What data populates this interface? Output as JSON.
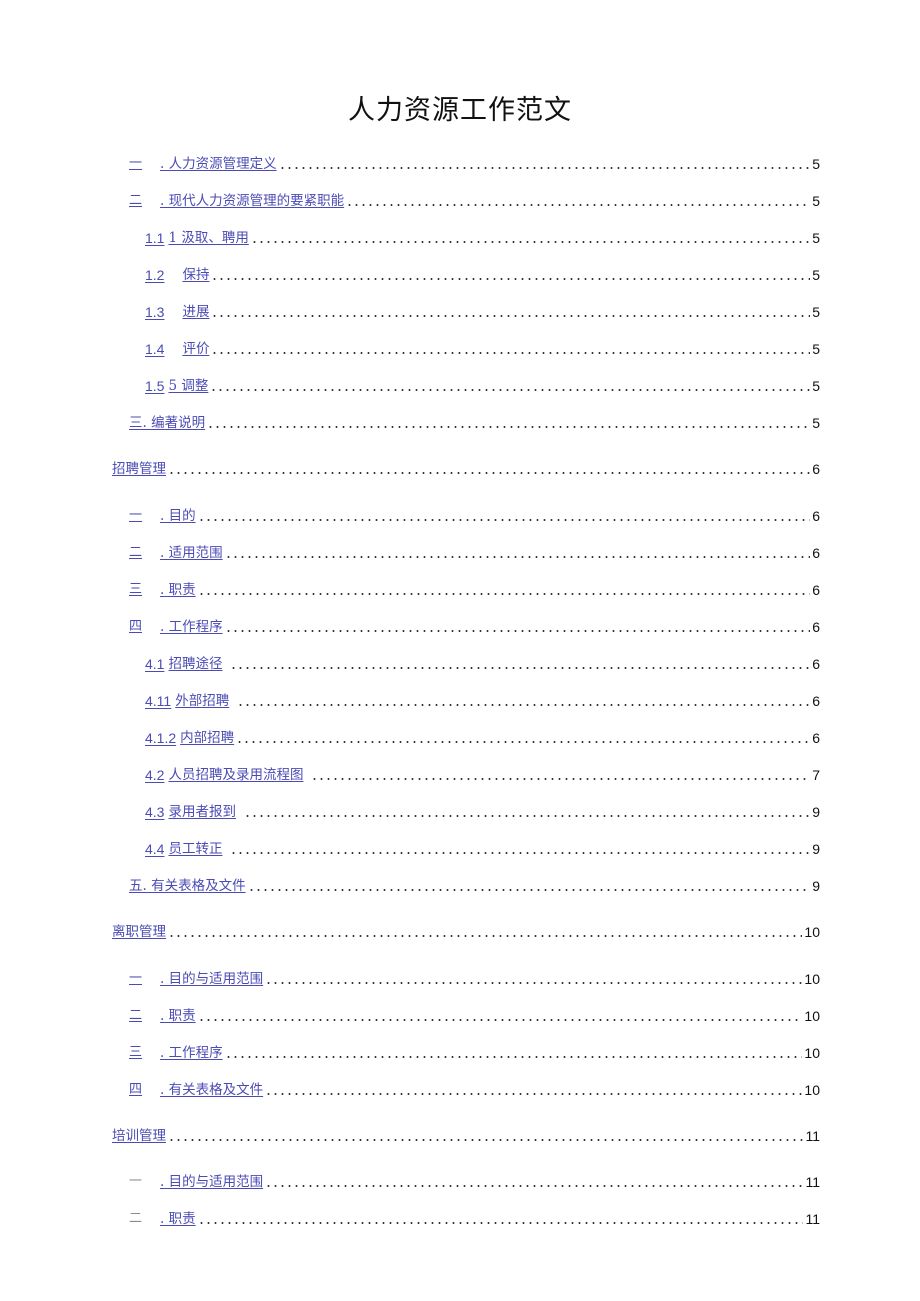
{
  "document": {
    "title": "人力资源工作范文"
  },
  "toc": [
    {
      "level": 1,
      "num": "一",
      "text": ". 人力资源管理定义",
      "page": "5"
    },
    {
      "level": 1,
      "num": "二",
      "text": ". 现代人力资源管理的要紧职能",
      "page": "5"
    },
    {
      "level": 2,
      "num": "1.1",
      "text": "1 汲取、聘用",
      "page": "5"
    },
    {
      "level": 2,
      "num": "1.2",
      "text": "保持",
      "page": "5"
    },
    {
      "level": 2,
      "num": "1.3",
      "text": "进展",
      "page": "5"
    },
    {
      "level": 2,
      "num": "1.4",
      "text": "评价",
      "page": "5"
    },
    {
      "level": 2,
      "num": "1.5",
      "text": "5 调整",
      "page": "5"
    },
    {
      "level": 1,
      "num": "",
      "text": "三. 编著说明",
      "page": "5"
    },
    {
      "level": 0,
      "num": "",
      "text": "招聘管理",
      "page": "6"
    },
    {
      "level": 1,
      "num": "一",
      "text": ". 目的",
      "page": "6"
    },
    {
      "level": 1,
      "num": "二",
      "text": ". 适用范围",
      "page": "6"
    },
    {
      "level": 1,
      "num": "三",
      "text": ". 职责",
      "page": "6"
    },
    {
      "level": 1,
      "num": "四",
      "text": ". 工作程序",
      "page": "6"
    },
    {
      "level": 2,
      "num": "4.1",
      "text": "招聘途径",
      "page": "6"
    },
    {
      "level": 2,
      "num": "4.11",
      "text": "外部招聘",
      "page": "6"
    },
    {
      "level": 2,
      "num": "4.1.2",
      "text": "内部招聘",
      "page": "6"
    },
    {
      "level": 2,
      "num": "4.2",
      "text": "人员招聘及录用流程图",
      "page": "7"
    },
    {
      "level": 2,
      "num": "4.3",
      "text": "录用者报到",
      "page": "9"
    },
    {
      "level": 2,
      "num": "4.4",
      "text": "员工转正",
      "page": "9"
    },
    {
      "level": 1,
      "num": "",
      "text": "五. 有关表格及文件",
      "page": "9"
    },
    {
      "level": 0,
      "num": "",
      "text": "离职管理",
      "page": "10"
    },
    {
      "level": 1,
      "num": "一",
      "text": ". 目的与适用范围",
      "page": "10"
    },
    {
      "level": 1,
      "num": "二",
      "text": ". 职责",
      "page": "10"
    },
    {
      "level": 1,
      "num": "三",
      "text": ". 工作程序",
      "page": "10"
    },
    {
      "level": 1,
      "num": "四",
      "text": ". 有关表格及文件",
      "page": "10"
    },
    {
      "level": 0,
      "num": "",
      "text": "培训管理",
      "page": "11"
    },
    {
      "level": 1,
      "num": "一",
      "text": ". 目的与适用范围",
      "page": "11",
      "num_plain": true
    },
    {
      "level": 1,
      "num": "二",
      "text": ". 职责",
      "page": "11",
      "num_plain": true
    }
  ],
  "colors": {
    "link": "#4b4bb5",
    "text": "#111111",
    "muted_numeral": "#8a8a9a"
  }
}
